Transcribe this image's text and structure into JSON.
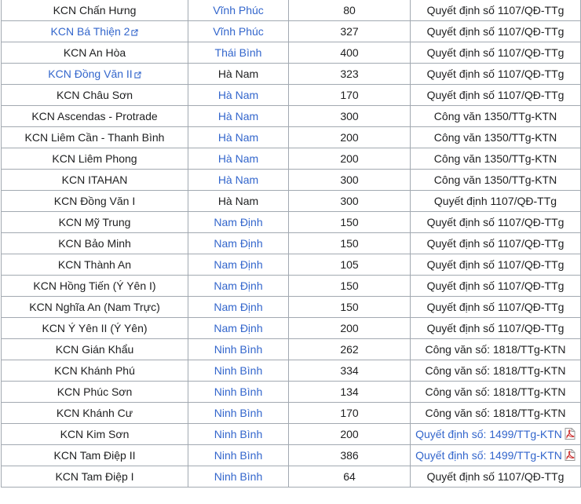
{
  "rows": [
    {
      "name": "KCN Chấn Hưng",
      "name_link": false,
      "name_ext": false,
      "province": "Vĩnh Phúc",
      "province_link": true,
      "area": "80",
      "decision": "Quyết định số 1107/QĐ-TTg",
      "decision_link": false,
      "decision_pdf": false
    },
    {
      "name": "KCN Bá Thiện 2",
      "name_link": true,
      "name_ext": true,
      "province": "Vĩnh Phúc",
      "province_link": true,
      "area": "327",
      "decision": "Quyết định số 1107/QĐ-TTg",
      "decision_link": false,
      "decision_pdf": false
    },
    {
      "name": "KCN An Hòa",
      "name_link": false,
      "name_ext": false,
      "province": "Thái Bình",
      "province_link": true,
      "area": "400",
      "decision": "Quyết định số 1107/QĐ-TTg",
      "decision_link": false,
      "decision_pdf": false
    },
    {
      "name": "KCN Đồng Văn II",
      "name_link": true,
      "name_ext": true,
      "province": "Hà Nam",
      "province_link": false,
      "area": "323",
      "decision": "Quyết định số 1107/QĐ-TTg",
      "decision_link": false,
      "decision_pdf": false
    },
    {
      "name": "KCN Châu Sơn",
      "name_link": false,
      "name_ext": false,
      "province": "Hà Nam",
      "province_link": true,
      "area": "170",
      "decision": "Quyết định số 1107/QĐ-TTg",
      "decision_link": false,
      "decision_pdf": false
    },
    {
      "name": "KCN Ascendas - Protrade",
      "name_link": false,
      "name_ext": false,
      "province": "Hà Nam",
      "province_link": true,
      "area": "300",
      "decision": "Công văn 1350/TTg-KTN",
      "decision_link": false,
      "decision_pdf": false
    },
    {
      "name": "KCN Liêm Cần - Thanh Bình",
      "name_link": false,
      "name_ext": false,
      "province": "Hà Nam",
      "province_link": true,
      "area": "200",
      "decision": "Công văn 1350/TTg-KTN",
      "decision_link": false,
      "decision_pdf": false
    },
    {
      "name": "KCN Liêm Phong",
      "name_link": false,
      "name_ext": false,
      "province": "Hà Nam",
      "province_link": true,
      "area": "200",
      "decision": "Công văn 1350/TTg-KTN",
      "decision_link": false,
      "decision_pdf": false
    },
    {
      "name": "KCN ITAHAN",
      "name_link": false,
      "name_ext": false,
      "province": "Hà Nam",
      "province_link": true,
      "area": "300",
      "decision": "Công văn 1350/TTg-KTN",
      "decision_link": false,
      "decision_pdf": false
    },
    {
      "name": "KCN Đồng Văn I",
      "name_link": false,
      "name_ext": false,
      "province": "Hà Nam",
      "province_link": false,
      "area": "300",
      "decision": "Quyết định 1107/QĐ-TTg",
      "decision_link": false,
      "decision_pdf": false
    },
    {
      "name": "KCN Mỹ Trung",
      "name_link": false,
      "name_ext": false,
      "province": "Nam Định",
      "province_link": true,
      "area": "150",
      "decision": "Quyết định số 1107/QĐ-TTg",
      "decision_link": false,
      "decision_pdf": false
    },
    {
      "name": "KCN Bảo Minh",
      "name_link": false,
      "name_ext": false,
      "province": "Nam Định",
      "province_link": true,
      "area": "150",
      "decision": "Quyết định số 1107/QĐ-TTg",
      "decision_link": false,
      "decision_pdf": false
    },
    {
      "name": "KCN Thành An",
      "name_link": false,
      "name_ext": false,
      "province": "Nam Định",
      "province_link": true,
      "area": "105",
      "decision": "Quyết định số 1107/QĐ-TTg",
      "decision_link": false,
      "decision_pdf": false
    },
    {
      "name": "KCN Hồng Tiến (Ý Yên I)",
      "name_link": false,
      "name_ext": false,
      "province": "Nam Định",
      "province_link": true,
      "area": "150",
      "decision": "Quyết định số 1107/QĐ-TTg",
      "decision_link": false,
      "decision_pdf": false
    },
    {
      "name": "KCN Nghĩa An (Nam Trực)",
      "name_link": false,
      "name_ext": false,
      "province": "Nam Định",
      "province_link": true,
      "area": "150",
      "decision": "Quyết định số 1107/QĐ-TTg",
      "decision_link": false,
      "decision_pdf": false
    },
    {
      "name": "KCN Ý Yên II (Ý Yên)",
      "name_link": false,
      "name_ext": false,
      "province": "Nam Định",
      "province_link": true,
      "area": "200",
      "decision": "Quyết định số 1107/QĐ-TTg",
      "decision_link": false,
      "decision_pdf": false
    },
    {
      "name": "KCN Gián Khẩu",
      "name_link": false,
      "name_ext": false,
      "province": "Ninh Bình",
      "province_link": true,
      "area": "262",
      "decision": "Công văn số: 1818/TTg-KTN",
      "decision_link": false,
      "decision_pdf": false
    },
    {
      "name": "KCN Khánh Phú",
      "name_link": false,
      "name_ext": false,
      "province": "Ninh Bình",
      "province_link": true,
      "area": "334",
      "decision": "Công văn số: 1818/TTg-KTN",
      "decision_link": false,
      "decision_pdf": false
    },
    {
      "name": "KCN Phúc Sơn",
      "name_link": false,
      "name_ext": false,
      "province": "Ninh Bình",
      "province_link": true,
      "area": "134",
      "decision": "Công văn số: 1818/TTg-KTN",
      "decision_link": false,
      "decision_pdf": false
    },
    {
      "name": "KCN Khánh Cư",
      "name_link": false,
      "name_ext": false,
      "province": "Ninh Bình",
      "province_link": true,
      "area": "170",
      "decision": "Công văn số: 1818/TTg-KTN",
      "decision_link": false,
      "decision_pdf": false
    },
    {
      "name": "KCN Kim Sơn",
      "name_link": false,
      "name_ext": false,
      "province": "Ninh Bình",
      "province_link": true,
      "area": "200",
      "decision": "Quyết định số: 1499/TTg-KTN",
      "decision_link": true,
      "decision_pdf": true
    },
    {
      "name": "KCN Tam Điệp II",
      "name_link": false,
      "name_ext": false,
      "province": "Ninh Bình",
      "province_link": true,
      "area": "386",
      "decision": "Quyết định số: 1499/TTg-KTN",
      "decision_link": true,
      "decision_pdf": true
    },
    {
      "name": "KCN Tam Điệp I",
      "name_link": false,
      "name_ext": false,
      "province": "Ninh Bình",
      "province_link": true,
      "area": "64",
      "decision": "Quyết định số 1107/QĐ-TTg",
      "decision_link": false,
      "decision_pdf": false
    }
  ],
  "colors": {
    "link": "#3366cc",
    "text": "#202122",
    "border": "#a2a9b1",
    "pdf": "#cc3333"
  },
  "icons": {
    "external": "external-link-icon",
    "pdf": "pdf-icon"
  }
}
